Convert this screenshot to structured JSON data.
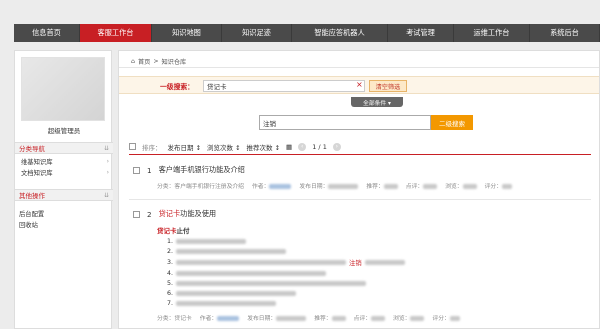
{
  "nav": {
    "tabs": [
      {
        "label": "信息首页",
        "active": false
      },
      {
        "label": "客服工作台",
        "active": true
      },
      {
        "label": "知识地图",
        "active": false
      },
      {
        "label": "知识足迹",
        "active": false
      },
      {
        "label": "智能应答机器人",
        "active": false
      },
      {
        "label": "考试管理",
        "active": false
      },
      {
        "label": "运维工作台",
        "active": false
      },
      {
        "label": "系统后台",
        "active": false
      }
    ]
  },
  "sidebar": {
    "username": "超级管理员",
    "section1": "分类导航",
    "items": [
      "维基知识库",
      "文档知识库"
    ],
    "section2": "其他操作",
    "items2": [
      "后台配置",
      "回收站"
    ]
  },
  "breadcrumb": {
    "home": "首页",
    "sep": ">",
    "current": "知识仓库"
  },
  "search": {
    "label": "一级搜索：",
    "value": "贷记卡",
    "clear_icon": "×",
    "clear_button": "清空筛选",
    "all_conditions": "全部条件 ▾",
    "secondary_value": "注销",
    "secondary_button": "二级搜索"
  },
  "sortbar": {
    "select_label": "排序：",
    "publish_date": "发布日期 ↕",
    "view_count": "浏览次数 ↕",
    "recommend_count": "推荐次数 ↕",
    "page_current": "1",
    "page_sep": "/",
    "page_total": "1"
  },
  "results": [
    {
      "num": "1",
      "title": "客户端手机银行功能及介绍",
      "meta_category": "分类：客户端手机银行注册及介绍",
      "meta_author": "作者：",
      "meta_date": "发布日期：",
      "meta_recommend": "推荐：",
      "meta_comment": "点评：",
      "meta_view": "浏览：",
      "meta_score": "评分："
    },
    {
      "num": "2",
      "title_hl": "贷记卡",
      "title_rest": "功能及使用",
      "snippet_title_hl": "贷记卡",
      "snippet_title_rest": "止付",
      "snippet_lines": [
        "1.",
        "2.",
        "3.",
        "4.",
        "5.",
        "6.",
        "7."
      ],
      "snippet_hl_word": "注销",
      "meta_category": "分类：贷记卡",
      "meta_author": "作者：",
      "meta_date": "发布日期：",
      "meta_recommend": "推荐：",
      "meta_comment": "点评：",
      "meta_view": "浏览：",
      "meta_score": "评分："
    }
  ],
  "colors": {
    "brand_red": "#c81f24",
    "nav_bg": "#4a4a4a",
    "orange": "#f39800"
  }
}
